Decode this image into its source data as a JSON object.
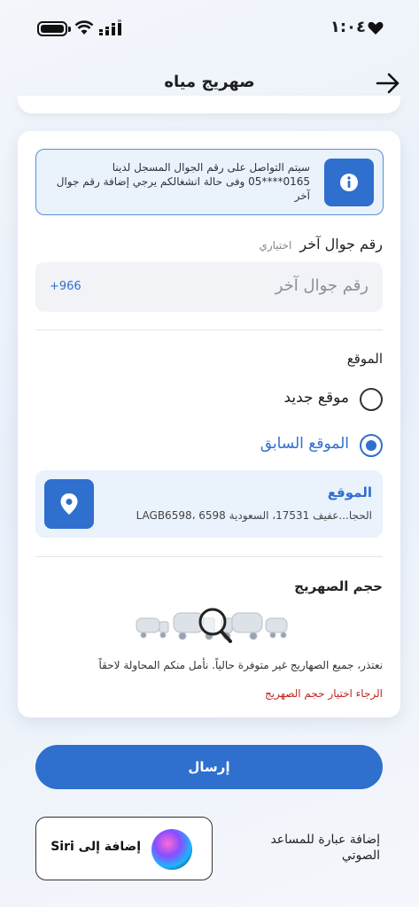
{
  "status_bar": {
    "time": "١:٠٤"
  },
  "header": {
    "title": "صهريج مياه"
  },
  "info": {
    "message": "سيتم التواصل على رقم الجوال المسجل لدينا 0165****05 وفى حالة انشغالكم يرجي إضافة رقم جوال آخر"
  },
  "phone": {
    "label": "رقم جوال آخر",
    "optional": "اختياري",
    "placeholder": "رقم جوال آخر",
    "country_code": "+966"
  },
  "location": {
    "title": "الموقع",
    "options": [
      {
        "label": "موقع جديد",
        "selected": false
      },
      {
        "label": "الموقع السابق",
        "selected": true
      }
    ],
    "address_title": "الموقع",
    "address_text": "الحجا...عفيف 17531، السعودية 6598 ،LAGB6598"
  },
  "tank": {
    "title": "حجم الصهريج",
    "unavailable_message": "نعتذر، جميع الصهاريج غير متوفرة حالياً. نأمل منكم المحاولة لاحقاً",
    "error": "الرجاء اختيار حجم الصهريج"
  },
  "submit_label": "إرسال",
  "siri": {
    "button_label": "إضافة إلى Siri",
    "description": "إضافة عبارة للمساعد الصوتي"
  },
  "colors": {
    "primary": "#2f6fce",
    "error": "#c0261f",
    "info_bg": "#eaf2fc"
  }
}
